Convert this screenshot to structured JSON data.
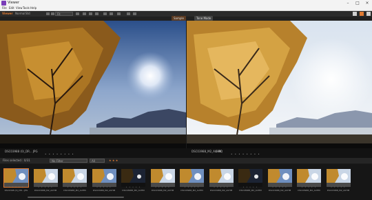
{
  "window": {
    "title": "Viewer"
  },
  "menu": [
    "File",
    "Edit",
    "View",
    "Tools",
    "Help"
  ],
  "toolbar": {
    "brand": "Viewer",
    "mode": "Normal",
    "mode2": "Std",
    "zoom": "Fit"
  },
  "left_pane": {
    "tag": "Sample",
    "filename": "DSC03988 (0)_DR... JPG",
    "rating": "• • • • •  • • •"
  },
  "right_pane": {
    "tag": "Tone Mode",
    "filename": "DSC03988_M2_AUHM",
    "extra": "C RQ",
    "rating": "• • • • •  • • •"
  },
  "filmstrip": {
    "count_label": "Files selected : 0/31",
    "dropdown": "No Filter",
    "dropdown2": "All",
    "thumbs": [
      {
        "label": "DSC0398 (0)_DR....JPG"
      },
      {
        "label": "DSC03988_M2_AUHM"
      },
      {
        "label": "DSC03988_M2_AUHM"
      },
      {
        "label": "DSC03988_M2_AUHM"
      },
      {
        "label": "DSC03988_M2_AUHM"
      },
      {
        "label": "DSC03988_M2_AUHM"
      },
      {
        "label": "DSC03988_M2_AUHM"
      },
      {
        "label": "DSC03988_M2_AUHM"
      },
      {
        "label": "DSC03988_M2_AUHM"
      },
      {
        "label": "DSC03988_M2_AUHM"
      },
      {
        "label": "DSC03988_M2_AUHM"
      },
      {
        "label": "DSC03988_M2_AUHM"
      }
    ]
  },
  "colors": {
    "accent": "#e07a32",
    "bg": "#1a1a1a"
  }
}
